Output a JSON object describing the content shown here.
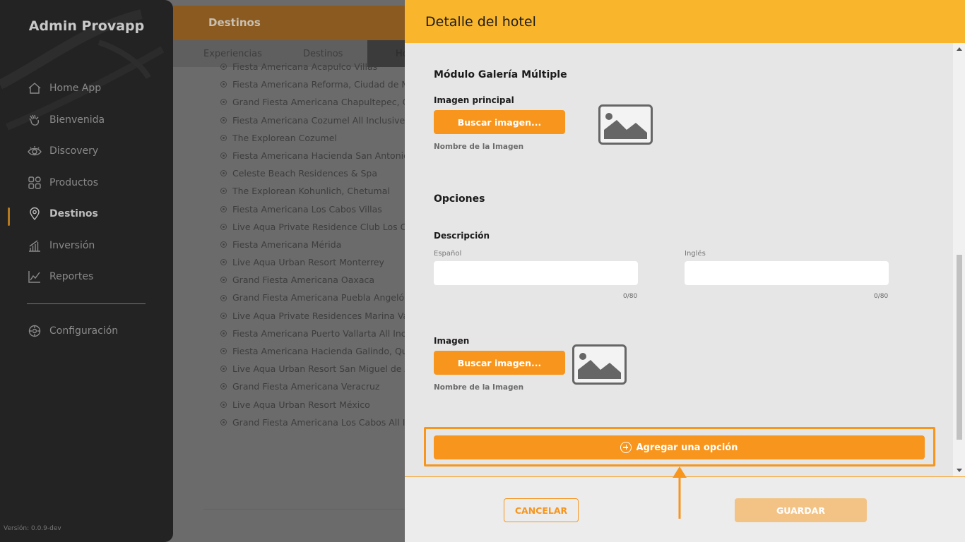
{
  "sidebar": {
    "brand": "Admin Provapp",
    "items": [
      {
        "label": "Home App",
        "icon": "home-icon"
      },
      {
        "label": "Bienvenida",
        "icon": "hand-wave-icon"
      },
      {
        "label": "Discovery",
        "icon": "eye-icon"
      },
      {
        "label": "Productos",
        "icon": "grid-icon"
      },
      {
        "label": "Destinos",
        "icon": "location-pin-icon",
        "active": true
      },
      {
        "label": "Inversión",
        "icon": "bar-chart-icon"
      },
      {
        "label": "Reportes",
        "icon": "line-chart-icon"
      }
    ],
    "settings": {
      "label": "Configuración",
      "icon": "gear-icon"
    },
    "version": "Versión: 0.0.9-dev"
  },
  "background": {
    "header_title": "Destinos",
    "tabs": [
      "Experiencias",
      "Destinos",
      "Ho"
    ],
    "hotels": [
      "Fiesta Americana Acapulco Villas",
      "Fiesta Americana Reforma, Ciudad de México",
      "Grand Fiesta Americana Chapultepec, Ciudad de México",
      "Fiesta Americana Cozumel All Inclusive",
      "The Explorean Cozumel",
      "Fiesta Americana Hacienda San Antonio El Puente",
      "Celeste Beach Residences & Spa",
      "The Explorean Kohunlich, Chetumal",
      "Fiesta Americana Los Cabos Villas",
      "Live Aqua Private Residence Club Los Cabos",
      "Fiesta Americana Mérida",
      "Live Aqua Urban Resort Monterrey",
      "Grand Fiesta Americana Oaxaca",
      "Grand Fiesta Americana Puebla Angelópolis",
      "Live Aqua Private Residences Marina Vallarta",
      "Fiesta Americana Puerto Vallarta All Inclusive",
      "Fiesta Americana Hacienda Galindo, Querétaro",
      "Live Aqua Urban Resort San Miguel de Allende",
      "Grand Fiesta Americana Veracruz",
      "Live Aqua Urban Resort México",
      "Grand Fiesta Americana Los Cabos All Inclusive"
    ]
  },
  "modal": {
    "title": "Detalle del hotel",
    "gallery": {
      "title": "Módulo Galería Múltiple",
      "main_image_label": "Imagen principal",
      "search_button": "Buscar imagen...",
      "file_name_label": "Nombre de la Imagen"
    },
    "options": {
      "title": "Opciones",
      "description_label": "Descripción",
      "spanish_label": "Español",
      "english_label": "Inglés",
      "spanish_value": "",
      "english_value": "",
      "spanish_counter": "0/80",
      "english_counter": "0/80",
      "image_label": "Imagen",
      "search_button": "Buscar imagen...",
      "file_name_label": "Nombre de la Imagen",
      "add_option_button": "Agregar una opción"
    },
    "footer": {
      "cancel": "CANCELAR",
      "save": "GUARDAR"
    }
  },
  "colors": {
    "accent": "#f7951d",
    "header": "#f9b52b",
    "sidebar": "#232323",
    "save_disabled": "#f2c385"
  }
}
